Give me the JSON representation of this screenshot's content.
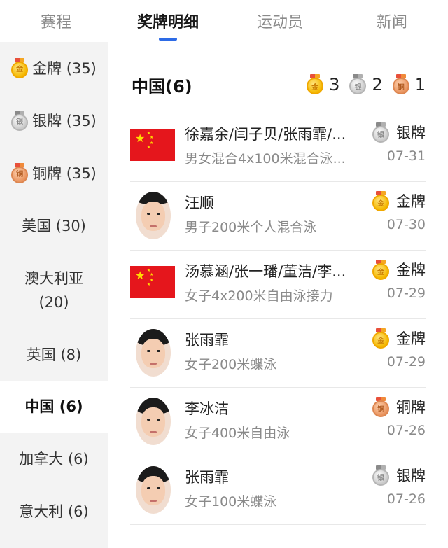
{
  "tabs": [
    {
      "label": "赛程"
    },
    {
      "label": "奖牌明细"
    },
    {
      "label": "运动员"
    },
    {
      "label": "新闻"
    }
  ],
  "sidebar": {
    "items": [
      {
        "label": "金牌 (35)",
        "medal": "gold",
        "medal_text": "金"
      },
      {
        "label": "银牌 (35)",
        "medal": "silver",
        "medal_text": "银"
      },
      {
        "label": "铜牌 (35)",
        "medal": "bronze",
        "medal_text": "铜"
      },
      {
        "label": "美国 (30)"
      },
      {
        "label": "澳大利亚\n(20)"
      },
      {
        "label": "英国 (8)"
      },
      {
        "label": "中国 (6)"
      },
      {
        "label": "加拿大 (6)"
      },
      {
        "label": "意大利 (6)"
      }
    ]
  },
  "main": {
    "title": "中国(6)",
    "summary": [
      {
        "medal": "gold",
        "medal_text": "金",
        "count": "3"
      },
      {
        "medal": "silver",
        "medal_text": "银",
        "count": "2"
      },
      {
        "medal": "bronze",
        "medal_text": "铜",
        "count": "1"
      }
    ],
    "rows": [
      {
        "name": "徐嘉余/闫子贝/张雨霏/...",
        "event": "男女混合4x100米混合泳...",
        "medal_label": "银牌",
        "medal": "silver",
        "medal_text": "银",
        "date": "07-31",
        "image": "flag"
      },
      {
        "name": "汪顺",
        "event": "男子200米个人混合泳",
        "medal_label": "金牌",
        "medal": "gold",
        "medal_text": "金",
        "date": "07-30",
        "image": "avatar"
      },
      {
        "name": "汤慕涵/张一璠/董洁/李...",
        "event": "女子4x200米自由泳接力",
        "medal_label": "金牌",
        "medal": "gold",
        "medal_text": "金",
        "date": "07-29",
        "image": "flag"
      },
      {
        "name": "张雨霏",
        "event": "女子200米蝶泳",
        "medal_label": "金牌",
        "medal": "gold",
        "medal_text": "金",
        "date": "07-29",
        "image": "avatar"
      },
      {
        "name": "李冰洁",
        "event": "女子400米自由泳",
        "medal_label": "铜牌",
        "medal": "bronze",
        "medal_text": "铜",
        "date": "07-26",
        "image": "avatar"
      },
      {
        "name": "张雨霏",
        "event": "女子100米蝶泳",
        "medal_label": "银牌",
        "medal": "silver",
        "medal_text": "银",
        "date": "07-26",
        "image": "avatar"
      }
    ]
  }
}
